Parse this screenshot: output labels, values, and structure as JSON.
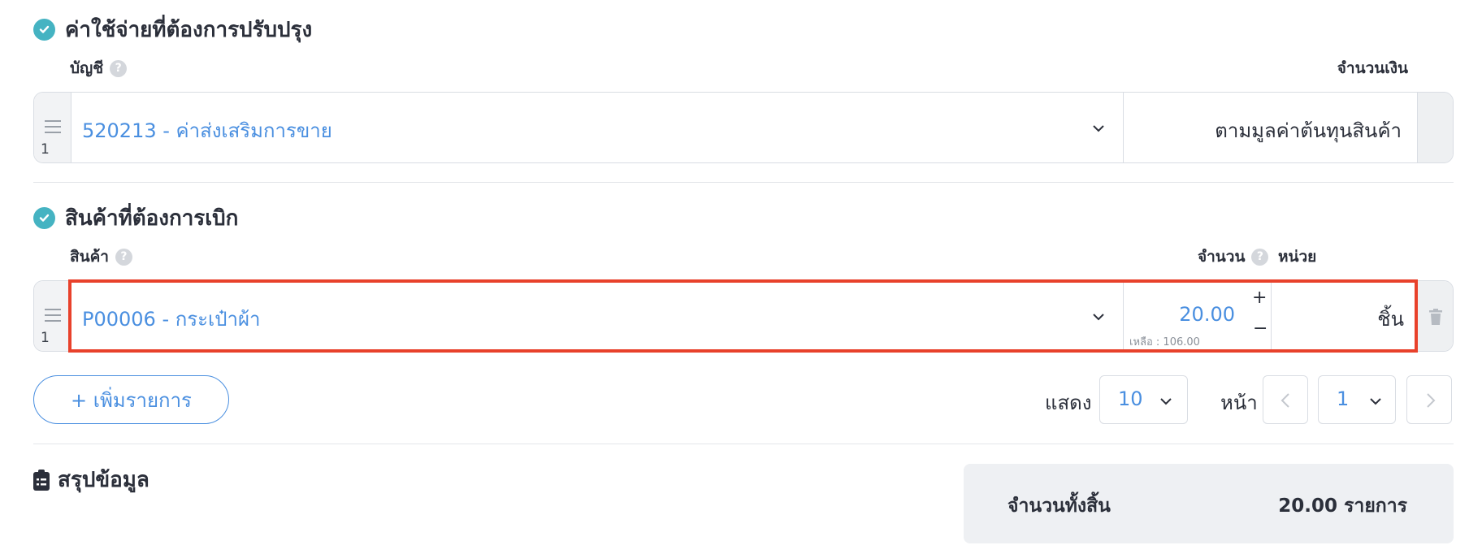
{
  "expense_section": {
    "title": "ค่าใช้จ่ายที่ต้องการปรับปรุง",
    "col_account": "บัญชี",
    "col_amount": "จำนวนเงิน",
    "rows": [
      {
        "index": "1",
        "account": "520213 - ค่าส่งเสริมการขาย",
        "amount": "ตามมูลค่าต้นทุนสินค้า"
      }
    ]
  },
  "product_section": {
    "title": "สินค้าที่ต้องการเบิก",
    "col_product": "สินค้า",
    "col_qty": "จำนวน",
    "col_unit": "หน่วย",
    "rows": [
      {
        "index": "1",
        "product": "P00006 - กระเป๋าผ้า",
        "qty": "20.00",
        "remaining": "เหลือ : 106.00",
        "unit": "ชิ้น"
      }
    ]
  },
  "add_button": "+ เพิ่มรายการ",
  "pagination": {
    "show_label": "แสดง",
    "page_size": "10",
    "page_label": "หน้า",
    "page": "1"
  },
  "summary": {
    "title": "สรุปข้อมูล",
    "total_label": "จำนวนทั้งสิ้น",
    "total_value": "20.00 รายการ"
  },
  "colors": {
    "accent": "#4a8fe0",
    "check": "#45b3c2",
    "highlight": "#e8412b"
  }
}
